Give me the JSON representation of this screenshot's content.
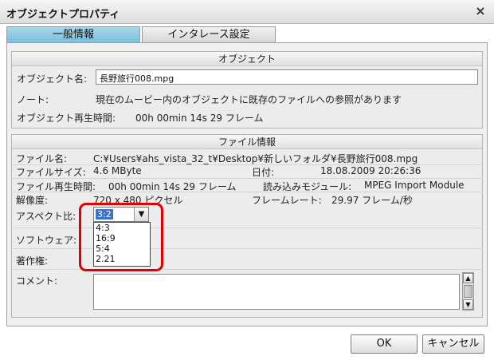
{
  "window": {
    "title": "オブジェクトプロパティ",
    "close_glyph": "×"
  },
  "tabs": [
    {
      "label": "一般情報",
      "active": true
    },
    {
      "label": "インタレース設定",
      "active": false
    }
  ],
  "object_group": {
    "heading": "オブジェクト",
    "name_label": "オブジェクト名:",
    "name_value": "長野旅行008.mpg",
    "note_label": "ノート:",
    "note_value": "現在のムービー内のオブジェクトに既存のファイルへの参照があります",
    "duration_label": "オブジェクト再生時間:",
    "duration_value": "00h 00min 14s 29 フレーム"
  },
  "file_group": {
    "heading": "ファイル情報",
    "filename_label": "ファイル名:",
    "filename_value": "C:¥Users¥ahs_vista_32_t¥Desktop¥新しいフォルダ¥長野旅行008.mpg",
    "size_label": "ファイルサイズ:",
    "size_value": "4.6 MByte",
    "date_label": "日付:",
    "date_value": "18.08.2009 20:26:36",
    "duration_label": "ファイル再生時間:",
    "duration_value": "00h 00min 14s 29 フレーム",
    "module_label": "読み込みモジュール:",
    "module_value": "MPEG Import Module",
    "resolution_label": "解像度:",
    "resolution_value": "720 x 480 ピクセル",
    "framerate_label": "フレームレート:",
    "framerate_value": "29.97 フレーム/秒",
    "aspect_label": "アスペクト比:",
    "aspect_selected": "3:2",
    "aspect_options": [
      "4:3",
      "16:9",
      "5:4",
      "2.21"
    ],
    "software_label": "ソフトウェア:",
    "copyright_label": "著作権:",
    "comment_label": "コメント:"
  },
  "buttons": {
    "ok": "OK",
    "cancel": "キャンセル"
  },
  "colors": {
    "active_tab": "#7cc0dc",
    "highlight": "#3b73c8",
    "annotation": "#e10000"
  }
}
